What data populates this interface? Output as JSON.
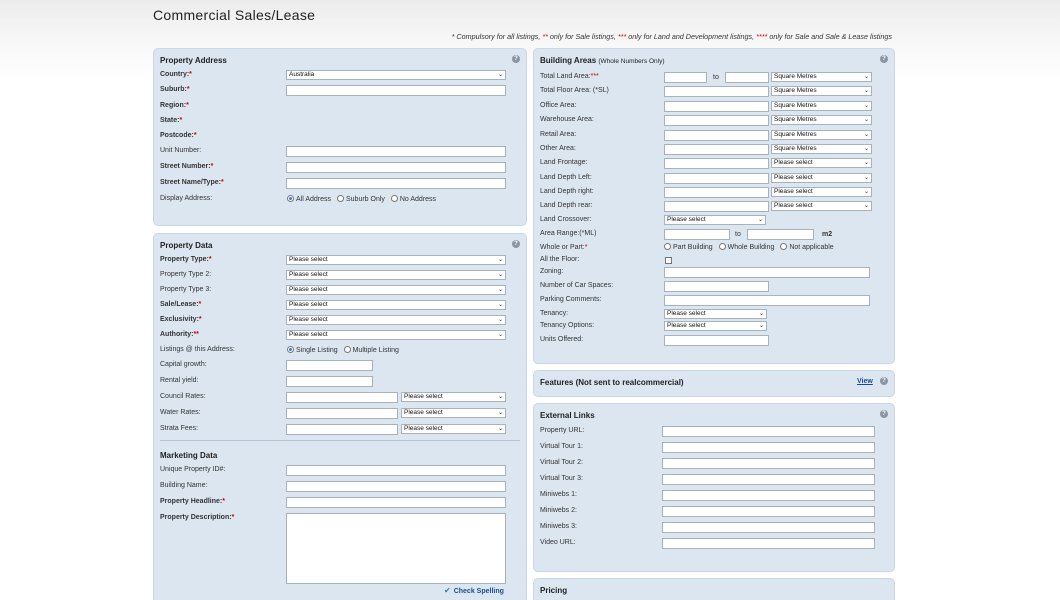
{
  "page": {
    "title": "Commercial Sales/Lease",
    "legend": {
      "p1": "* Compulsory for all listings, ",
      "s2": "**",
      "p2": " only for Sale listings, ",
      "s3": "***",
      "p3": " only for Land and Development listings, ",
      "s4": "****",
      "p4": " only for Sale and Sale & Lease listings"
    }
  },
  "address": {
    "title": "Property Address",
    "country_label": "Country:",
    "country_value": "Australia",
    "suburb_label": "Suburb:",
    "region_label": "Region:",
    "state_label": "State:",
    "postcode_label": "Postcode:",
    "unit_label": "Unit Number:",
    "street_number_label": "Street Number:",
    "street_name_label": "Street Name/Type:",
    "display_label": "Display Address:",
    "display_opts": [
      "All Address",
      "Suburb Only",
      "No Address"
    ]
  },
  "pdata": {
    "title": "Property Data",
    "please": "Please select",
    "type_label": "Property Type:",
    "type2_label": "Property Type 2:",
    "type3_label": "Property Type 3:",
    "sale_lease_label": "Sale/Lease:",
    "exclusivity_label": "Exclusivity:",
    "authority_label": "Authority:",
    "authority_req": "**",
    "listings_label": "Listings @ this Address:",
    "listing_opts": [
      "Single Listing",
      "Multiple Listing"
    ],
    "capital_label": "Capital growth:",
    "rental_label": "Rental yield:",
    "council_label": "Council Rates:",
    "water_label": "Water Rates:",
    "strata_label": "Strata Fees:"
  },
  "marketing": {
    "title": "Marketing Data",
    "unique_id_label": "Unique Property ID#:",
    "building_label": "Building Name:",
    "headline_label": "Property Headline:",
    "description_label": "Property Description:",
    "spell": "Check Spelling"
  },
  "building": {
    "title": "Building Areas",
    "subtitle": "(Whole Numbers Only)",
    "sqm": "Square Metres",
    "please": "Please select",
    "to": "to",
    "m2": "m2",
    "total_land_label": "Total Land Area:",
    "total_land_req": "***",
    "total_floor_label": "Total Floor Area: (*SL)",
    "office_label": "Office Area:",
    "warehouse_label": "Warehouse Area:",
    "retail_label": "Retail Area:",
    "other_label": "Other Area:",
    "frontage_label": "Land Frontage:",
    "depth_left_label": "Land Depth Left:",
    "depth_right_label": "Land Depth right:",
    "depth_rear_label": "Land Depth rear:",
    "crossover_label": "Land Crossover:",
    "area_range_label": "Area Range:(*ML)",
    "whole_part_label": "Whole or Part:",
    "whole_part_opts": [
      "Part Building",
      "Whole Building",
      "Not applicable"
    ],
    "all_floor_label": "All the Floor:",
    "zoning_label": "Zoning:",
    "car_spaces_label": "Number of Car Spaces:",
    "parking_label": "Parking Comments:",
    "tenancy_label": "Tenancy:",
    "tenancy_options_label": "Tenancy Options:",
    "units_label": "Units Offered:"
  },
  "features": {
    "title": "Features (Not sent to realcommercial)",
    "view": "View"
  },
  "links": {
    "title": "External Links",
    "property_url": "Property URL:",
    "vt1": "Virtual Tour 1:",
    "vt2": "Virtual Tour 2:",
    "vt3": "Virtual Tour 3:",
    "mw1": "Miniwebs 1:",
    "mw2": "Miniwebs 2:",
    "mw3": "Miniwebs 3:",
    "video": "Video URL:"
  },
  "pricing": {
    "title": "Pricing"
  },
  "icons": {
    "help": "help-icon",
    "chevron": "chevron-down-icon",
    "spell": "check-spelling-icon"
  }
}
